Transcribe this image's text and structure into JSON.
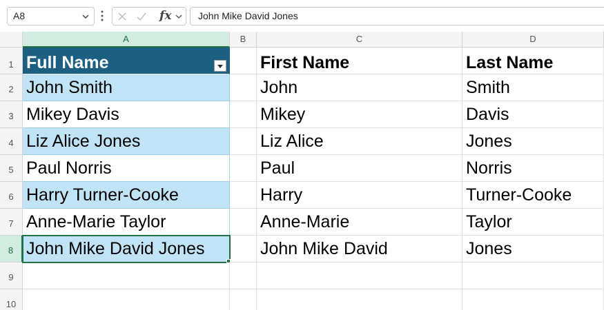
{
  "formula_bar": {
    "name_box": "A8",
    "formula": "John Mike David Jones"
  },
  "column_headers": [
    "A",
    "B",
    "C",
    "D"
  ],
  "row_headers": [
    "1",
    "2",
    "3",
    "4",
    "5",
    "6",
    "7",
    "8",
    "9",
    "10"
  ],
  "cells": {
    "A": [
      "Full Name",
      "John Smith",
      "Mikey Davis",
      "Liz Alice Jones",
      "Paul Norris",
      "Harry Turner-Cooke",
      "Anne-Marie Taylor",
      "John Mike David Jones"
    ],
    "C": [
      "First Name",
      "John",
      "Mikey",
      "Liz Alice",
      "Paul",
      "Harry",
      "Anne-Marie",
      "John Mike David"
    ],
    "D": [
      "Last Name",
      "Smith",
      "Davis",
      "Jones",
      "Norris",
      "Turner-Cooke",
      "Taylor",
      "Jones"
    ]
  },
  "colors": {
    "table_header": "#1c5f80",
    "table_band": "#c0e4f5",
    "selection": "#217346"
  }
}
